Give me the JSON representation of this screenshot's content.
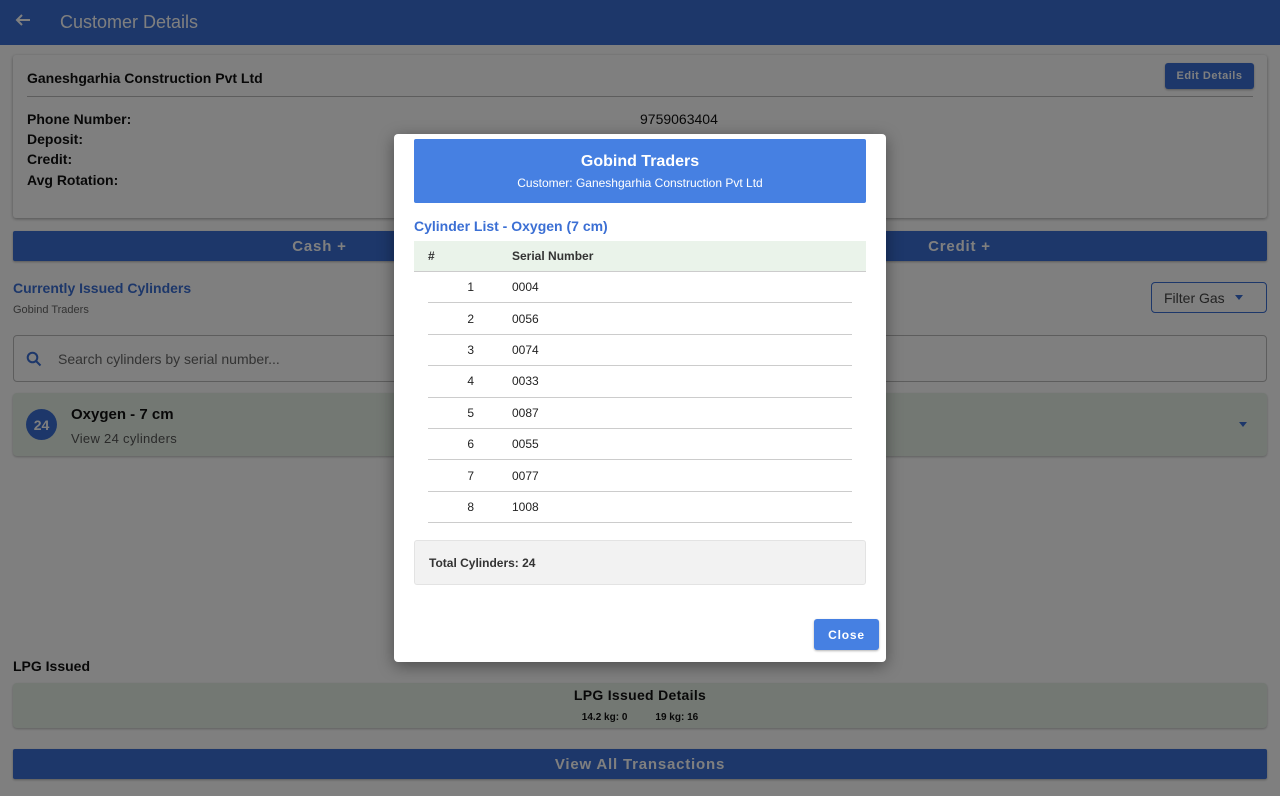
{
  "appbar": {
    "title": "Customer Details",
    "back_icon": "arrow-left-icon"
  },
  "customer": {
    "name": "Ganeshgarhia Construction Pvt Ltd",
    "edit_label": "Edit Details",
    "phone_label": "Phone Number:",
    "phone_value": "9759063404",
    "deposit_label": "Deposit:",
    "credit_label": "Credit:",
    "rotation_label": "Avg Rotation:"
  },
  "actions": {
    "cash_label": "Cash +",
    "credit_label": "Credit +"
  },
  "issued": {
    "title": "Currently Issued Cylinders",
    "subtitle": "Gobind Traders",
    "filter_label": "Filter Gas",
    "search_placeholder": "Search cylinders by serial number...",
    "gas_group": {
      "count": "24",
      "name": "Oxygen - 7 cm",
      "sub": "View 24 cylinders"
    }
  },
  "lpg": {
    "section_title": "LPG Issued",
    "card_title": "LPG Issued Details",
    "stat_14": "14.2 kg: 0",
    "stat_19": "19 kg: 16"
  },
  "transactions_label": "View All Transactions",
  "modal": {
    "title": "Gobind Traders",
    "subtitle": "Customer: Ganeshgarhia Construction Pvt Ltd",
    "list_title": "Cylinder List - Oxygen (7 cm)",
    "col_num": "#",
    "col_serial": "Serial Number",
    "rows": [
      {
        "num": "1",
        "serial": "0004"
      },
      {
        "num": "2",
        "serial": "0056"
      },
      {
        "num": "3",
        "serial": "0074"
      },
      {
        "num": "4",
        "serial": "0033"
      },
      {
        "num": "5",
        "serial": "0087"
      },
      {
        "num": "6",
        "serial": "0055"
      },
      {
        "num": "7",
        "serial": "0077"
      },
      {
        "num": "8",
        "serial": "1008"
      }
    ],
    "total": "Total Cylinders: 24",
    "close_label": "Close"
  },
  "colors": {
    "primary": "#3b6fd4",
    "modal_header": "#4680e2",
    "group_bg": "#e6f1e6"
  }
}
